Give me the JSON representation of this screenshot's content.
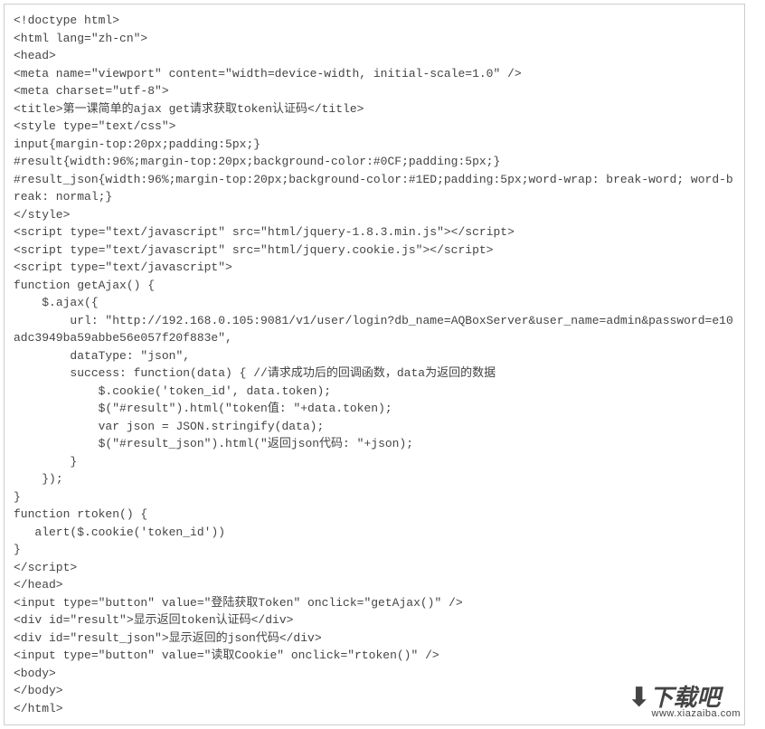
{
  "code": "<!doctype html>\n<html lang=\"zh-cn\">\n<head>\n<meta name=\"viewport\" content=\"width=device-width, initial-scale=1.0\" />\n<meta charset=\"utf-8\">\n<title>第一课简单的ajax get请求获取token认证码</title>\n<style type=\"text/css\">\ninput{margin-top:20px;padding:5px;}\n#result{width:96%;margin-top:20px;background-color:#0CF;padding:5px;}\n#result_json{width:96%;margin-top:20px;background-color:#1ED;padding:5px;word-wrap: break-word; word-break: normal;}\n</style>\n<script type=\"text/javascript\" src=\"html/jquery-1.8.3.min.js\"></script>\n<script type=\"text/javascript\" src=\"html/jquery.cookie.js\"></script>\n<script type=\"text/javascript\">\nfunction getAjax() {\n    $.ajax({\n        url: \"http://192.168.0.105:9081/v1/user/login?db_name=AQBoxServer&user_name=admin&password=e10adc3949ba59abbe56e057f20f883e\",\n        dataType: \"json\",\n        success: function(data) { //请求成功后的回调函数，data为返回的数据\n            $.cookie('token_id', data.token);\n            $(\"#result\").html(\"token值: \"+data.token);\n            var json = JSON.stringify(data);\n            $(\"#result_json\").html(\"返回json代码: \"+json);\n        }\n    });\n}\nfunction rtoken() {\n   alert($.cookie('token_id'))\n}\n</script>\n</head>\n<input type=\"button\" value=\"登陆获取Token\" onclick=\"getAjax()\" />\n<div id=\"result\">显示返回token认证码</div>\n<div id=\"result_json\">显示返回的json代码</div>\n<input type=\"button\" value=\"读取Cookie\" onclick=\"rtoken()\" />\n<body>\n</body>\n</html>",
  "watermark": {
    "brand": "下载吧",
    "domain": "www.xiazaiba.com"
  }
}
